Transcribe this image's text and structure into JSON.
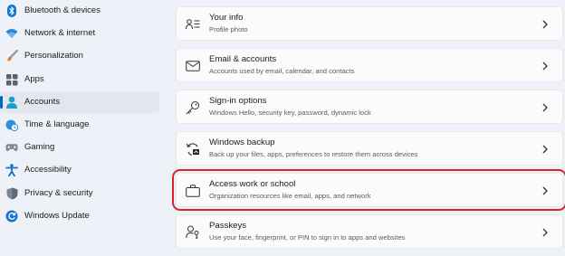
{
  "sidebar": {
    "items": [
      {
        "label": "Bluetooth & devices",
        "icon": "bluetooth-icon"
      },
      {
        "label": "Network & internet",
        "icon": "wifi-icon"
      },
      {
        "label": "Personalization",
        "icon": "brush-icon"
      },
      {
        "label": "Apps",
        "icon": "apps-icon"
      },
      {
        "label": "Accounts",
        "icon": "accounts-icon",
        "selected": true
      },
      {
        "label": "Time & language",
        "icon": "globe-clock-icon"
      },
      {
        "label": "Gaming",
        "icon": "gamepad-icon"
      },
      {
        "label": "Accessibility",
        "icon": "accessibility-icon"
      },
      {
        "label": "Privacy & security",
        "icon": "shield-icon"
      },
      {
        "label": "Windows Update",
        "icon": "update-icon"
      }
    ]
  },
  "cards": [
    {
      "title": "Your info",
      "subtitle": "Profile photo",
      "icon": "person-info-icon"
    },
    {
      "title": "Email & accounts",
      "subtitle": "Accounts used by email, calendar, and contacts",
      "icon": "mail-icon"
    },
    {
      "title": "Sign-in options",
      "subtitle": "Windows Hello, security key, password, dynamic lock",
      "icon": "key-icon"
    },
    {
      "title": "Windows backup",
      "subtitle": "Back up your files, apps, preferences to restore them across devices",
      "icon": "backup-icon"
    },
    {
      "title": "Access work or school",
      "subtitle": "Organization resources like email, apps, and network",
      "icon": "briefcase-icon",
      "highlighted": true
    },
    {
      "title": "Passkeys",
      "subtitle": "Use your face, fingerprint, or PIN to sign in to apps and websites",
      "icon": "passkey-icon"
    }
  ],
  "colors": {
    "accent": "#0067c0",
    "highlight": "#d9232d",
    "background": "#eef2f8",
    "card": "#fbfbfc"
  }
}
